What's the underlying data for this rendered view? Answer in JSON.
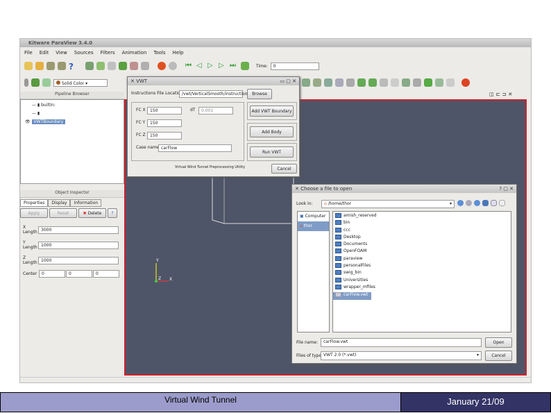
{
  "app": {
    "title": "Kitware ParaView 3.4.0",
    "menu": [
      "File",
      "Edit",
      "View",
      "Sources",
      "Filters",
      "Animation",
      "Tools",
      "Help"
    ],
    "time_label": "Time:",
    "time_value": "0",
    "color_select": "Solid Color"
  },
  "pipeline": {
    "title": "Pipeline Browser",
    "items": [
      "builtin:",
      "",
      "VWTBoundary"
    ]
  },
  "inspector": {
    "title": "Object Inspector",
    "tabs": [
      "Properties",
      "Display",
      "Information"
    ],
    "apply": "Apply",
    "reset": "Reset",
    "delete": "Delete",
    "fields": [
      {
        "label": "X Length",
        "value": "3000"
      },
      {
        "label": "Y Length",
        "value": "1000"
      },
      {
        "label": "Z Length",
        "value": "1000"
      }
    ],
    "center_label": "Center",
    "center": [
      "0",
      "0",
      "0"
    ]
  },
  "vwt": {
    "title": "VWT",
    "instr_label": "Instructions File Location",
    "instr_value": "/vwt/VerticalSmooth/instructions.txt",
    "browse": "Browse",
    "fcx_label": "FC X",
    "fcx": "150",
    "dt_label": "dT",
    "dt": "0.001",
    "fcy_label": "FC Y",
    "fcy": "150",
    "fcz_label": "FC Z",
    "fcz": "150",
    "case_label": "Case name",
    "case": "carFlow",
    "add_boundary": "Add VWT Boundary",
    "add_body": "Add Body",
    "run": "Run VWT",
    "footer": "Virtual Wind Tunnel Preprocessing Utility",
    "cancel": "Cancel"
  },
  "filedlg": {
    "title": "Choose a file to open",
    "lookin_label": "Look in:",
    "lookin": "/home/thor",
    "places": [
      "Computer",
      "thor"
    ],
    "files": [
      "amish_reserved",
      "bin",
      "ccc",
      "Desktop",
      "Documents",
      "OpenFOAM",
      "paraview",
      "personalFiles",
      "swig_bin",
      "Universities",
      "wrapper_mfiles",
      "carFlow.vwt"
    ],
    "selected": "carFlow.vwt",
    "filename_label": "File name:",
    "filename": "carFlow.vwt",
    "type_label": "Files of type:",
    "type": "VWT 2.0 (*.vwt)",
    "open": "Open",
    "cancel": "Cancel"
  },
  "axes": {
    "y": "Y",
    "z": "Z",
    "x": "X"
  },
  "slide": {
    "footer_title": "Virtual Wind Tunnel",
    "date": "January 21/09"
  },
  "colors": {
    "render_bg": "#4f5568",
    "render_border": "#d0202a",
    "footer_left": "#9b9ccb",
    "footer_right": "#333366"
  }
}
